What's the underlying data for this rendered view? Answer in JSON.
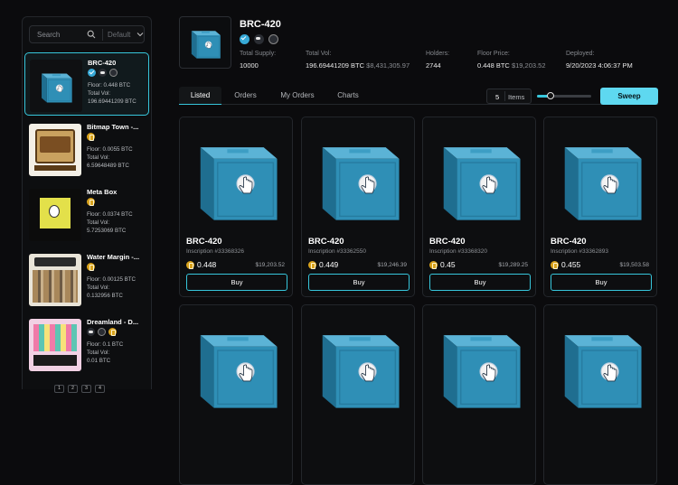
{
  "search": {
    "placeholder": "Search",
    "sort_value": "Default"
  },
  "collections": [
    {
      "name": "BRC-420",
      "floor": "Floor: 0.448 BTC",
      "vol_label": "Total Vol:",
      "vol": "196.69441209 BTC",
      "icons": [
        "verified-icon",
        "discord-icon",
        "globe-icon"
      ],
      "thumb": "cube"
    },
    {
      "name": "Bitmap Town -...",
      "floor": "Floor: 0.0055 BTC",
      "vol_label": "Total Vol:",
      "vol": "6.59648489 BTC",
      "icons": [
        "bitcoin-coin-icon"
      ],
      "thumb": "bitmap"
    },
    {
      "name": "Meta Box",
      "floor": "Floor: 0.0374 BTC",
      "vol_label": "Total Vol:",
      "vol": "5.7253069 BTC",
      "icons": [
        "bitcoin-coin-icon"
      ],
      "thumb": "metabox"
    },
    {
      "name": "Water Margin -...",
      "floor": "Floor: 0.00125 BTC",
      "vol_label": "Total Vol:",
      "vol": "0.132956 BTC",
      "icons": [
        "bitcoin-coin-icon"
      ],
      "thumb": "water"
    },
    {
      "name": "Dreamland - D...",
      "floor": "Floor: 0.1 BTC",
      "vol_label": "Total Vol:",
      "vol": "0.01 BTC",
      "icons": [
        "discord-icon",
        "globe-icon",
        "bitcoin-coin-icon"
      ],
      "thumb": "dream"
    }
  ],
  "header": {
    "title": "BRC-420",
    "stats": [
      {
        "label": "Total Supply:",
        "value": "10000",
        "sub": ""
      },
      {
        "label": "Total Vol:",
        "value": "196.69441209 BTC",
        "sub": "$8,431,305.97"
      },
      {
        "label": "Holders:",
        "value": "2744",
        "sub": ""
      },
      {
        "label": "Floor Price:",
        "value": "0.448 BTC",
        "sub": "$19,203.52"
      },
      {
        "label": "Deployed:",
        "value": "9/20/2023 4:06:37 PM",
        "sub": ""
      }
    ]
  },
  "tabs": [
    "Listed",
    "Orders",
    "My Orders",
    "Charts"
  ],
  "controls": {
    "items_count": "5",
    "items_label": "Items",
    "slider_fraction": 0.25,
    "sweep_label": "Sweep"
  },
  "cards": [
    {
      "name": "BRC-420",
      "inscription": "Inscription #33368326",
      "price": "0.448",
      "usd": "$19,203.52",
      "buy": "Buy"
    },
    {
      "name": "BRC-420",
      "inscription": "Inscription #33362550",
      "price": "0.449",
      "usd": "$19,246.39",
      "buy": "Buy"
    },
    {
      "name": "BRC-420",
      "inscription": "Inscription #33368320",
      "price": "0.45",
      "usd": "$19,289.25",
      "buy": "Buy"
    },
    {
      "name": "BRC-420",
      "inscription": "Inscription #33362893",
      "price": "0.455",
      "usd": "$19,503.58",
      "buy": "Buy"
    }
  ],
  "colors": {
    "accent": "#37c7dc",
    "sweep": "#5ed8f0",
    "cube": "#2f8fb6",
    "coin": "#d8a21c"
  },
  "pager": [
    "1",
    "2",
    "3",
    "4"
  ]
}
